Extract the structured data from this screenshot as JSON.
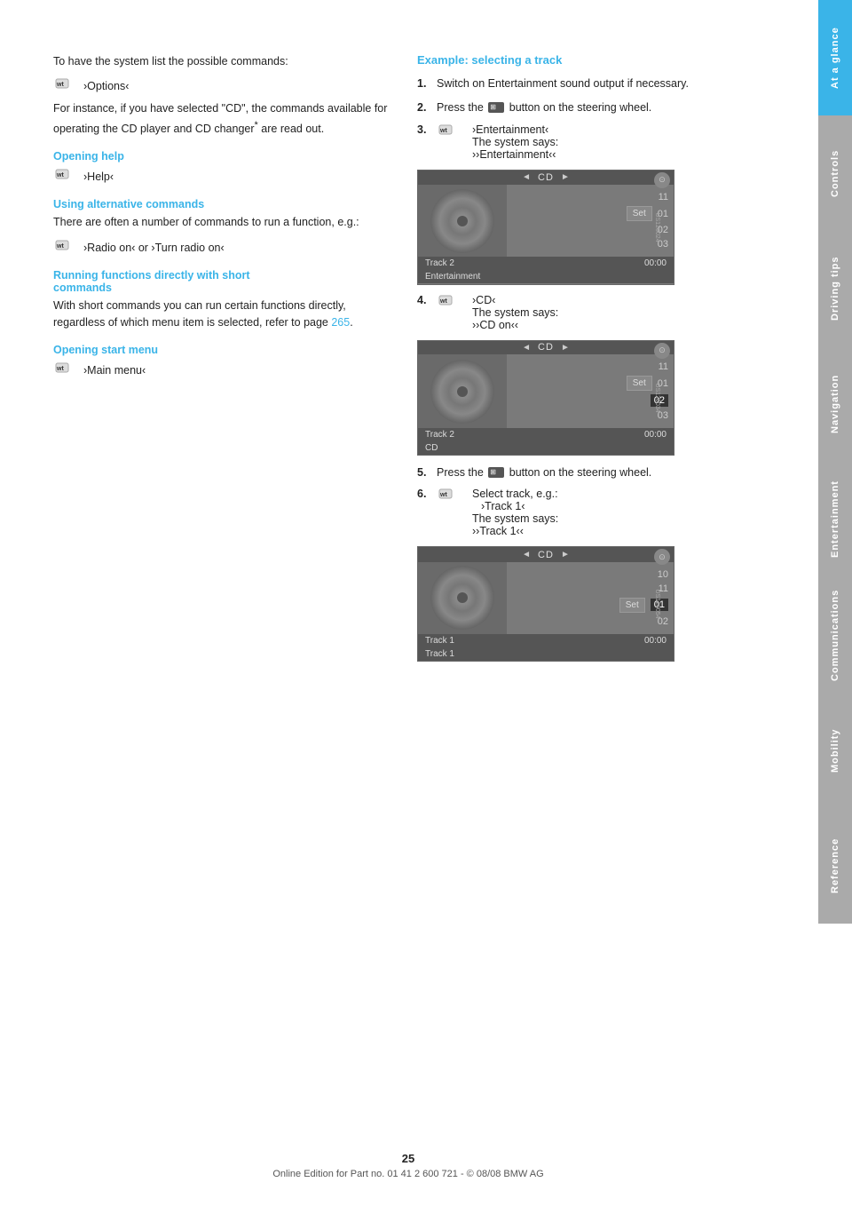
{
  "page": {
    "number": "25",
    "footer_text": "Online Edition for Part no. 01 41 2 600 721 - © 08/08 BMW AG"
  },
  "sidebar": {
    "tabs": [
      {
        "id": "at-a-glance",
        "label": "At a glance",
        "active": true
      },
      {
        "id": "controls",
        "label": "Controls",
        "active": false
      },
      {
        "id": "driving",
        "label": "Driving tips",
        "active": false
      },
      {
        "id": "navigation",
        "label": "Navigation",
        "active": false
      },
      {
        "id": "entertainment",
        "label": "Entertainment",
        "active": false
      },
      {
        "id": "communications",
        "label": "Communications",
        "active": false
      },
      {
        "id": "mobility",
        "label": "Mobility",
        "active": false
      },
      {
        "id": "reference",
        "label": "Reference",
        "active": false
      }
    ]
  },
  "left_column": {
    "para1": "To have the system list the possible commands:",
    "cmd_options": "›Options‹",
    "para2": "For instance, if you have selected \"CD\", the commands available for operating the CD player and CD changer* are read out.",
    "sections": [
      {
        "id": "opening-help",
        "heading": "Opening help",
        "command": "›Help‹"
      },
      {
        "id": "using-alternative-commands",
        "heading": "Using alternative commands",
        "body": "There are often a number of commands to run a function, e.g.:",
        "command": "›Radio on‹ or ›Turn radio on‹"
      },
      {
        "id": "running-functions",
        "heading": "Running functions directly with short commands",
        "body": "With short commands you can run certain functions directly, regardless of which menu item is selected, refer to page",
        "page_ref": "265",
        "body_end": "."
      },
      {
        "id": "opening-start-menu",
        "heading": "Opening start menu",
        "command": "›Main menu‹"
      }
    ]
  },
  "right_column": {
    "example_heading": "Example: selecting a track",
    "steps": [
      {
        "num": "1.",
        "text": "Switch on Entertainment sound output if necessary."
      },
      {
        "num": "2.",
        "text": "Press the",
        "button_label": "",
        "text2": "button on the steering wheel."
      },
      {
        "num": "3.",
        "has_icon": true,
        "command": "›Entertainment‹",
        "system_says": "The system says:",
        "response": "››Entertainment‹‹"
      }
    ],
    "screen1": {
      "top_label": "CD",
      "tracks": [
        "11",
        "01",
        "02",
        "03"
      ],
      "set_label": "Set",
      "bottom_left": "Track 2",
      "bottom_right": "00:00",
      "footer_label": "Entertainment",
      "highlighted_track": null,
      "watermark": "US120024"
    },
    "step4": {
      "num": "4.",
      "has_icon": true,
      "command": "›CD‹",
      "system_says": "The system says:",
      "response": "››CD on‹‹"
    },
    "screen2": {
      "top_label": "CD",
      "tracks": [
        "11",
        "01",
        "02",
        "03"
      ],
      "set_label": "Set",
      "bottom_left": "Track 2",
      "bottom_right": "00:00",
      "footer_label": "CD",
      "highlighted_track": "02",
      "watermark": "US120034"
    },
    "step5": {
      "num": "5.",
      "text": "Press the",
      "text2": "button on the steering wheel."
    },
    "step6": {
      "num": "6.",
      "has_icon": true,
      "command": "Select track, e.g.:",
      "sub_command": "›Track 1‹",
      "system_says": "The system says:",
      "response": "››Track 1‹‹"
    },
    "screen3": {
      "top_label": "CD",
      "tracks": [
        "10",
        "11",
        "01",
        "02"
      ],
      "set_label": "Set",
      "bottom_left": "Track 1",
      "bottom_right": "00:00",
      "footer_label": "Track 1",
      "highlighted_track": "01",
      "watermark": "US120054"
    }
  }
}
